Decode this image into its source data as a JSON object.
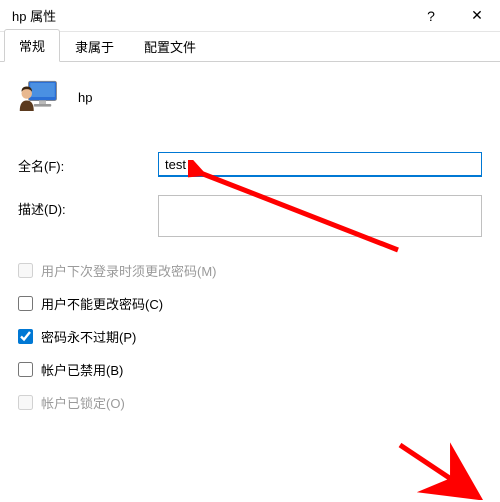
{
  "window": {
    "title": "hp 属性",
    "help": "?",
    "close": "✕"
  },
  "tabs": [
    {
      "label": "常规",
      "active": true
    },
    {
      "label": "隶属于",
      "active": false
    },
    {
      "label": "配置文件",
      "active": false
    }
  ],
  "user": {
    "name": "hp"
  },
  "fields": {
    "fullname_label": "全名(F):",
    "fullname_value": "test",
    "description_label": "描述(D):",
    "description_value": ""
  },
  "checkboxes": [
    {
      "label": "用户下次登录时须更改密码(M)",
      "checked": false,
      "disabled": true
    },
    {
      "label": "用户不能更改密码(C)",
      "checked": false,
      "disabled": false
    },
    {
      "label": "密码永不过期(P)",
      "checked": true,
      "disabled": false
    },
    {
      "label": "帐户已禁用(B)",
      "checked": false,
      "disabled": false
    },
    {
      "label": "帐户已锁定(O)",
      "checked": false,
      "disabled": true
    }
  ],
  "annotation": {
    "color": "#ff0000"
  }
}
